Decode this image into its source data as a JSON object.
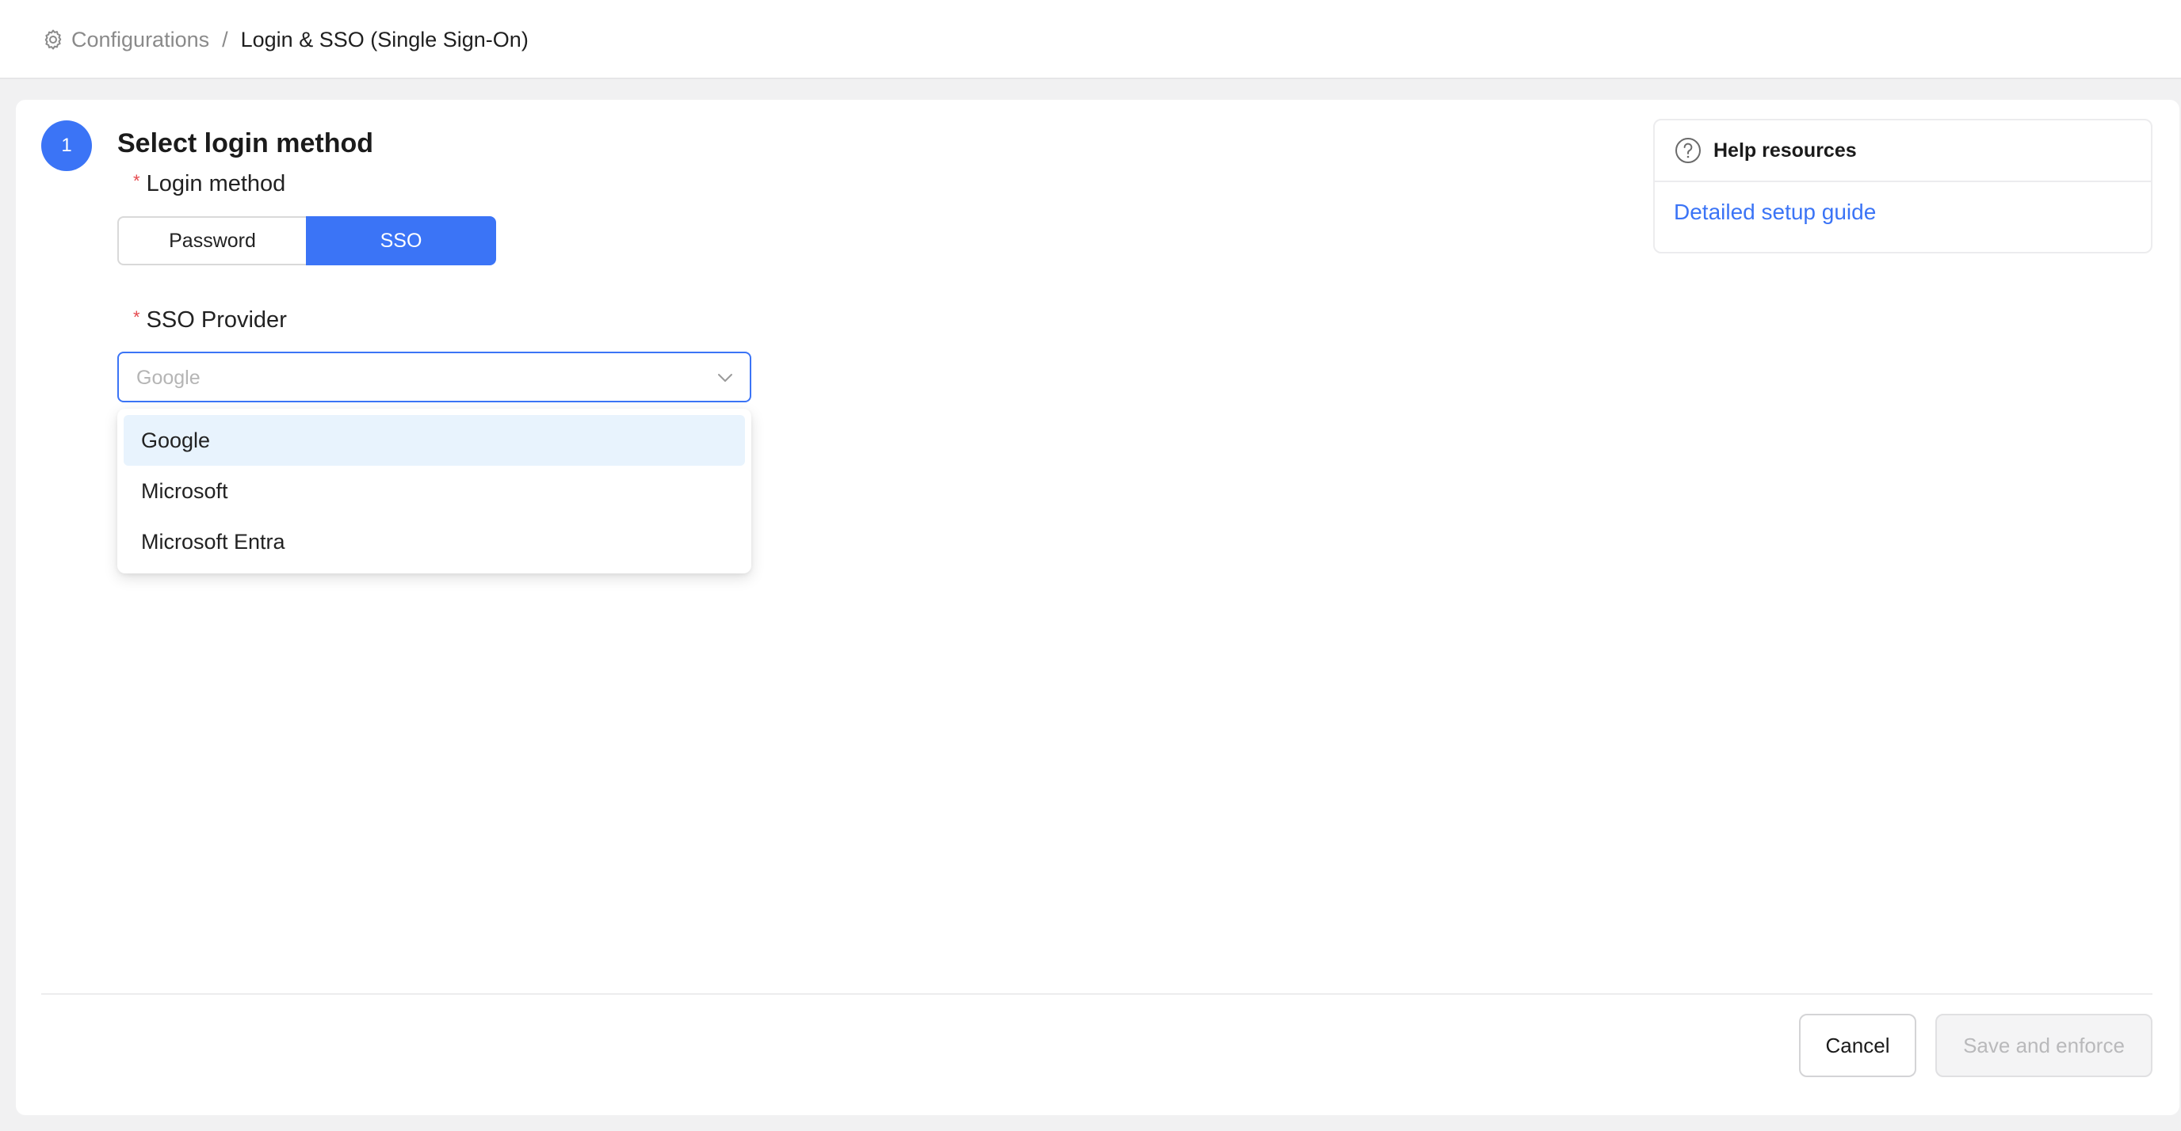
{
  "breadcrumb": {
    "root_icon": "gear-icon",
    "root": "Configurations",
    "separator": "/",
    "current": "Login & SSO (Single Sign-On)"
  },
  "step": {
    "number": "1",
    "title": "Select login method"
  },
  "login_method": {
    "required_mark": "*",
    "label": "Login method",
    "options": [
      "Password",
      "SSO"
    ],
    "selected": "SSO"
  },
  "sso_provider": {
    "required_mark": "*",
    "label": "SSO Provider",
    "placeholder": "Google",
    "chevron_icon": "chevron-down-icon",
    "options": [
      "Google",
      "Microsoft",
      "Microsoft Entra"
    ],
    "highlighted": "Google"
  },
  "help": {
    "icon": "question-circle-icon",
    "title": "Help resources",
    "link": "Detailed setup guide"
  },
  "footer": {
    "cancel_label": "Cancel",
    "save_label": "Save and enforce",
    "save_disabled": true
  },
  "colors": {
    "accent": "#3b74f6",
    "option_highlight": "#e8f3fd",
    "required": "#e5484d",
    "page_bg": "#f1f1f2"
  }
}
